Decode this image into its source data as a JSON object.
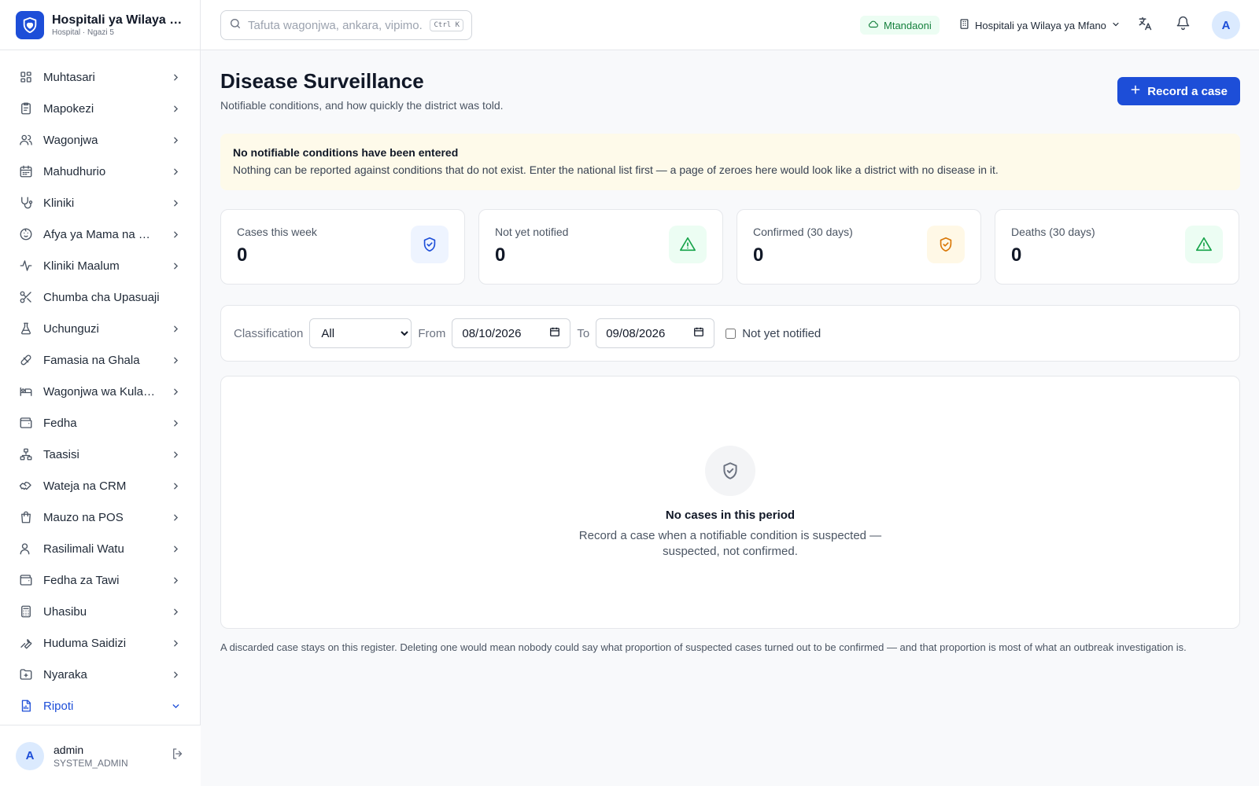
{
  "brand": {
    "name": "Hospitali ya Wilaya ya Mfano",
    "subtitle": "Hospital · Ngazi 5"
  },
  "sidebar": {
    "items": [
      {
        "label": "Muhtasari",
        "icon": "grid-icon",
        "chevron": "right"
      },
      {
        "label": "Mapokezi",
        "icon": "clipboard-icon",
        "chevron": "right"
      },
      {
        "label": "Wagonjwa",
        "icon": "users-icon",
        "chevron": "right"
      },
      {
        "label": "Mahudhurio",
        "icon": "calendar-icon",
        "chevron": "right"
      },
      {
        "label": "Kliniki",
        "icon": "stethoscope-icon",
        "chevron": "right"
      },
      {
        "label": "Afya ya Mama na Mtoto",
        "icon": "baby-icon",
        "chevron": "right"
      },
      {
        "label": "Kliniki Maalum",
        "icon": "activity-icon",
        "chevron": "right"
      },
      {
        "label": "Chumba cha Upasuaji",
        "icon": "scissors-icon",
        "chevron": "none"
      },
      {
        "label": "Uchunguzi",
        "icon": "flask-icon",
        "chevron": "right"
      },
      {
        "label": "Famasia na Ghala",
        "icon": "pill-icon",
        "chevron": "right"
      },
      {
        "label": "Wagonjwa wa Kulazwa",
        "icon": "bed-icon",
        "chevron": "right"
      },
      {
        "label": "Fedha",
        "icon": "wallet-icon",
        "chevron": "right"
      },
      {
        "label": "Taasisi",
        "icon": "network-icon",
        "chevron": "right"
      },
      {
        "label": "Wateja na CRM",
        "icon": "handshake-icon",
        "chevron": "right"
      },
      {
        "label": "Mauzo na POS",
        "icon": "shopping-bag-icon",
        "chevron": "right"
      },
      {
        "label": "Rasilimali Watu",
        "icon": "user-icon",
        "chevron": "right"
      },
      {
        "label": "Fedha za Tawi",
        "icon": "wallet-icon",
        "chevron": "right"
      },
      {
        "label": "Uhasibu",
        "icon": "calculator-icon",
        "chevron": "right"
      },
      {
        "label": "Huduma Saidizi",
        "icon": "wrench-icon",
        "chevron": "right"
      },
      {
        "label": "Nyaraka",
        "icon": "folder-icon",
        "chevron": "right"
      },
      {
        "label": "Ripoti",
        "icon": "report-icon",
        "chevron": "down",
        "active": true
      }
    ]
  },
  "user": {
    "initial": "A",
    "name": "admin",
    "role": "SYSTEM_ADMIN"
  },
  "header": {
    "search_placeholder": "Tafuta wagonjwa, ankara, vipimo...",
    "search_shortcut": "Ctrl K",
    "status": "Mtandaoni",
    "facility": "Hospitali ya Wilaya ya Mfano",
    "avatar_initial": "A"
  },
  "page": {
    "title": "Disease Surveillance",
    "subtitle": "Notifiable conditions, and how quickly the district was told.",
    "primary_button": "Record a case"
  },
  "alert": {
    "title": "No notifiable conditions have been entered",
    "body": "Nothing can be reported against conditions that do not exist. Enter the national list first — a page of zeroes here would look like a district with no disease in it."
  },
  "stats": [
    {
      "label": "Cases this week",
      "value": "0",
      "icon": "shield-check-icon",
      "bg": "#eef4ff",
      "color": "#1d4ed8"
    },
    {
      "label": "Not yet notified",
      "value": "0",
      "icon": "alert-triangle-icon",
      "bg": "#ecfdf3",
      "color": "#16a34a"
    },
    {
      "label": "Confirmed (30 days)",
      "value": "0",
      "icon": "shield-check-icon",
      "bg": "#fff8e6",
      "color": "#d97706"
    },
    {
      "label": "Deaths (30 days)",
      "value": "0",
      "icon": "alert-triangle-icon",
      "bg": "#ecfdf3",
      "color": "#16a34a"
    }
  ],
  "filters": {
    "classification_label": "Classification",
    "classification_value": "All",
    "from_label": "From",
    "from_value": "08/10/2026",
    "to_label": "To",
    "to_value": "09/08/2026",
    "not_notified_label": "Not yet notified"
  },
  "empty": {
    "title": "No cases in this period",
    "body": "Record a case when a notifiable condition is suspected — suspected, not confirmed."
  },
  "footnote": "A discarded case stays on this register. Deleting one would mean nobody could say what proportion of suspected cases turned out to be confirmed — and that proportion is most of what an outbreak investigation is.",
  "colors": {
    "accent": "#1d4ed8",
    "online": "#15803d",
    "alert_bg": "#fefaea"
  }
}
